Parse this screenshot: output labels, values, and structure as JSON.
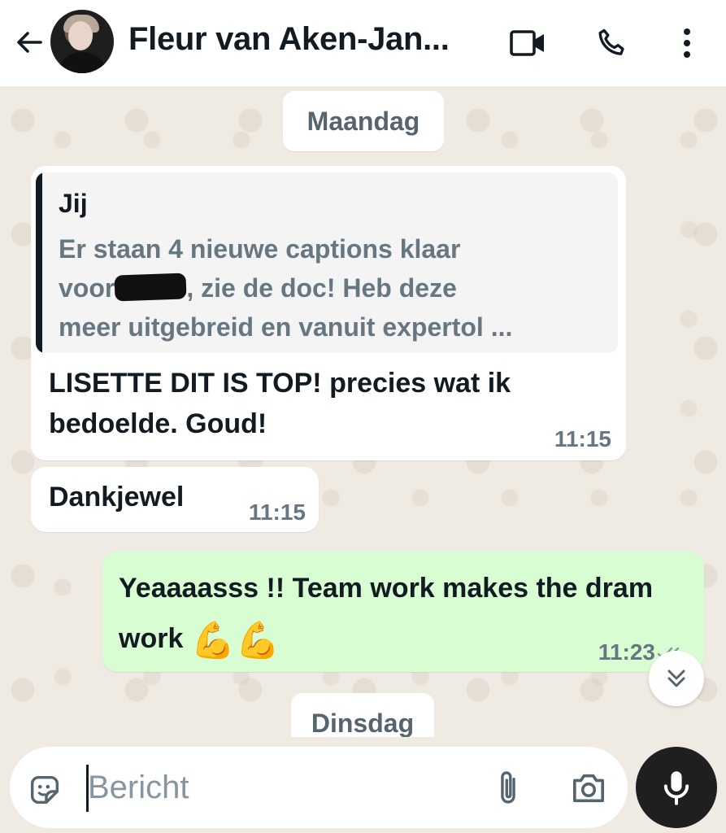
{
  "header": {
    "contact_name": "Fleur van Aken-Jan...",
    "icons": [
      "arrow-left-icon",
      "video-camera-icon",
      "phone-icon",
      "more-vertical-icon"
    ]
  },
  "chat": {
    "date_separators": [
      "Maandag",
      "Dinsdag"
    ],
    "messages": [
      {
        "direction": "incoming",
        "quote": {
          "author": "Jij",
          "text_line1": "Er staan 4 nieuwe captions klaar",
          "text_line2a": "voor",
          "text_line2b": ", zie de doc! Heb deze",
          "text_line3": "meer uitgebreid en vanuit expertol ..."
        },
        "text": "LISETTE DIT IS TOP! precies wat ik bedoelde. Goud!",
        "time": "11:15"
      },
      {
        "direction": "incoming",
        "text": "Dankjewel",
        "time": "11:15"
      },
      {
        "direction": "outgoing",
        "text": "Yeaaaasss !! Team work makes the dram work",
        "emoji": "💪💪",
        "time": "11:23",
        "status": "read"
      }
    ]
  },
  "composer": {
    "placeholder": "Bericht",
    "icons": [
      "sticker-icon",
      "paperclip-icon",
      "camera-icon",
      "microphone-icon"
    ]
  },
  "colors": {
    "chat_background": "#efeae2",
    "incoming_bubble": "#ffffff",
    "outgoing_bubble": "#d9fdd3",
    "timestamp": "#667781"
  }
}
